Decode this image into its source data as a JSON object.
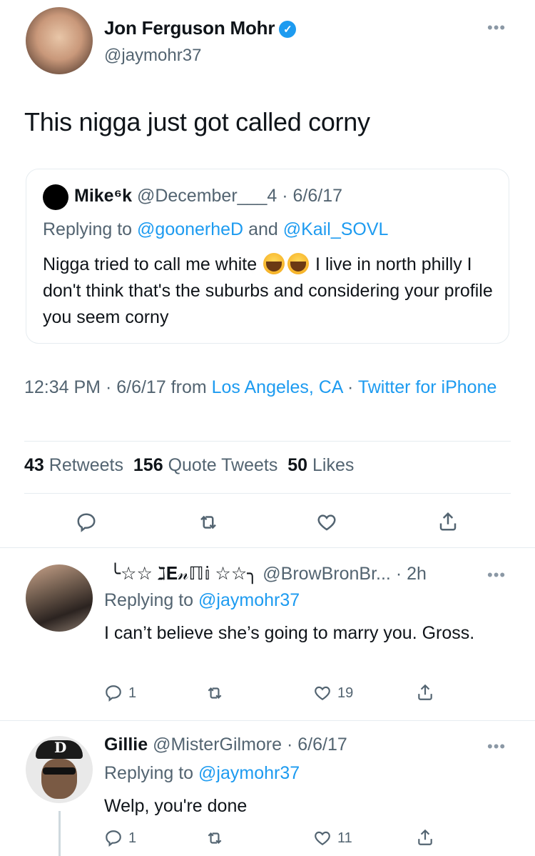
{
  "main_tweet": {
    "author_name": "Jon Ferguson Mohr",
    "author_handle": "@jaymohr37",
    "text": "This nigga just got called corny",
    "timestamp_time": "12:34 PM · 6/6/17 from ",
    "location": "Los Angeles, CA",
    "separator": " · ",
    "source": "Twitter for iPhone",
    "stats": {
      "retweets_count": "43",
      "retweets_label": "Retweets",
      "quotes_count": "156",
      "quotes_label": "Quote Tweets",
      "likes_count": "50",
      "likes_label": "Likes"
    },
    "quoted": {
      "author_name": "Mike⁶k",
      "author_handle": "@December___4",
      "date": "· 6/6/17",
      "replying_prefix": "Replying to",
      "replying_user1": "@goonerheD",
      "replying_and": "and",
      "replying_user2": "@Kail_SOVL",
      "text_before_emoji": "Nigga tried to call me white",
      "text_after_emoji": "I live in north philly I don't think that's the suburbs and considering your profile you seem corny"
    }
  },
  "replies": [
    {
      "author_name": "╰☆☆ ℷ𝐄𝓃ℿ𝕚 ☆☆╮",
      "author_handle": "@BrowBronBr...",
      "time": "· 2h",
      "replying_prefix": "Replying to",
      "replying_user": "@jaymohr37",
      "text": "I can’t believe she’s going to marry you. Gross.",
      "reply_count": "1",
      "like_count": "19"
    },
    {
      "author_name": "Gillie",
      "author_handle": "@MisterGilmore",
      "time": "· 6/6/17",
      "replying_prefix": "Replying to",
      "replying_user": "@jaymohr37",
      "text": "Welp, you're done",
      "reply_count": "1",
      "like_count": "11",
      "avatar_letter": "D"
    }
  ],
  "icons": {
    "verified": "verified-badge-icon",
    "more": "more-dots-icon",
    "reply": "reply-icon",
    "retweet": "retweet-icon",
    "like": "heart-icon",
    "share": "share-icon"
  },
  "colors": {
    "accent": "#1d9bf0",
    "secondary_text": "#536471",
    "border": "#e6ecf0"
  }
}
